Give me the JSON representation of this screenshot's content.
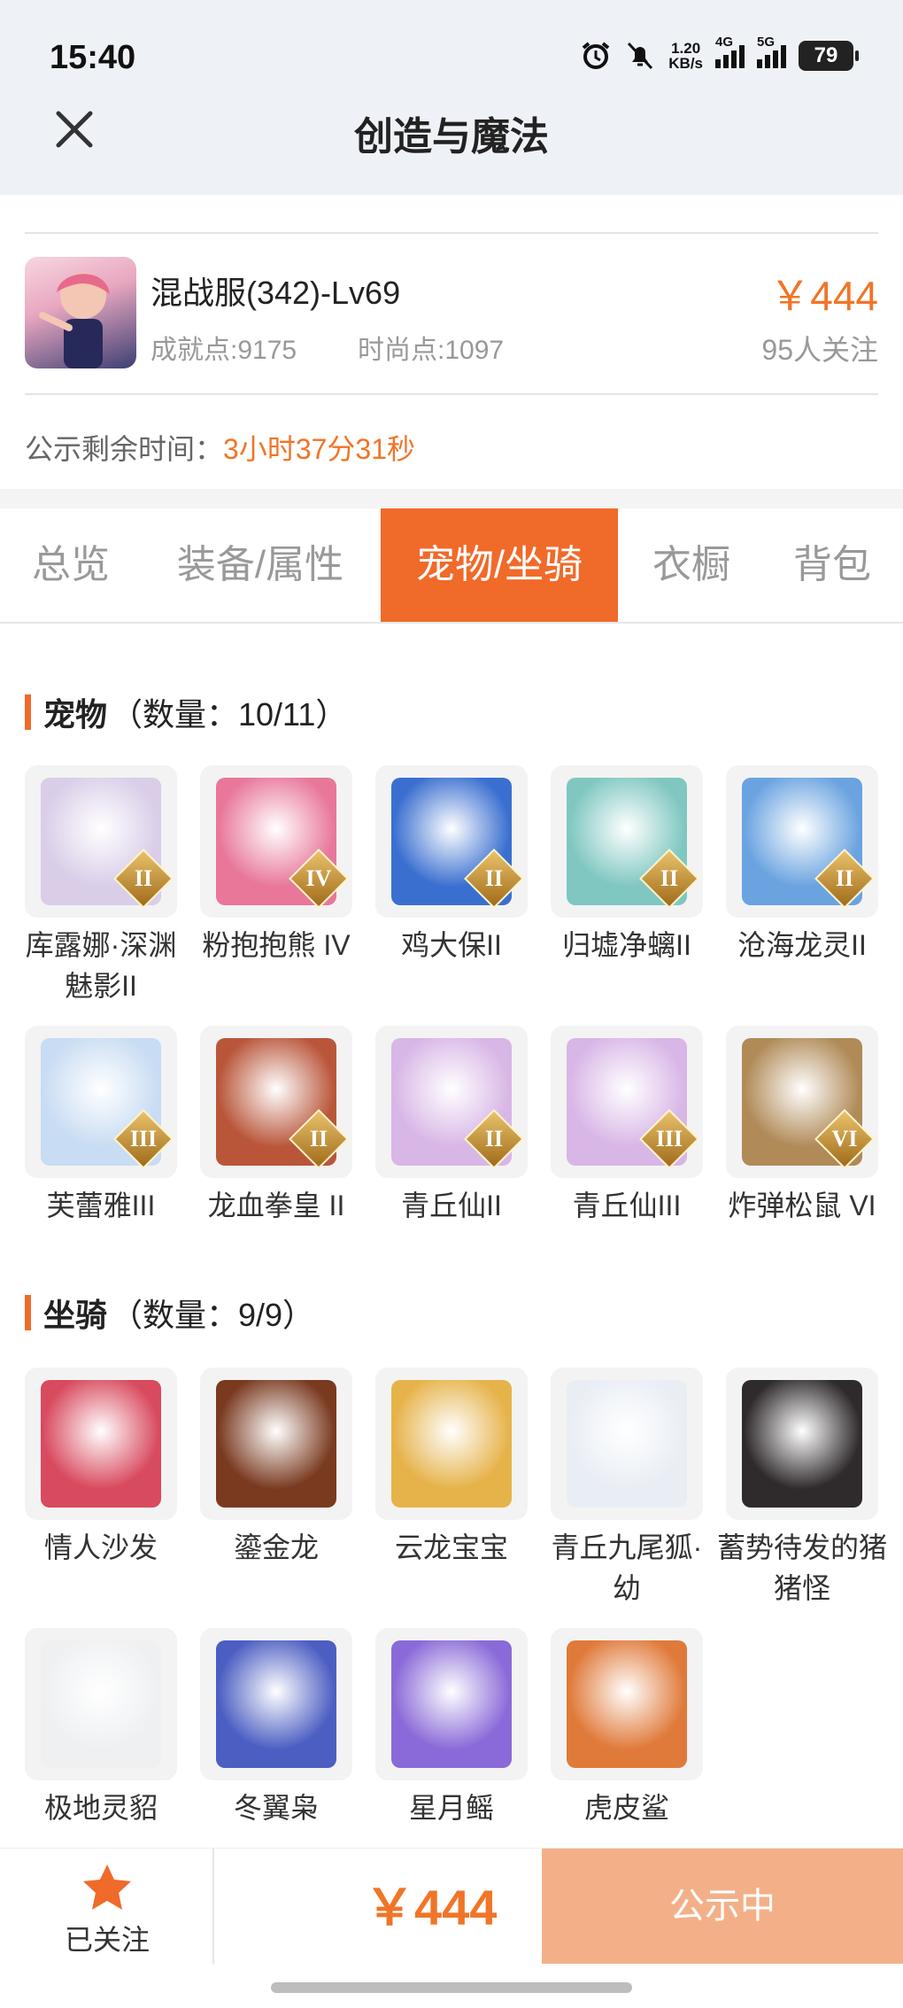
{
  "status_bar": {
    "time": "15:40",
    "speed": "1.20",
    "speed_unit": "KB/s",
    "net1": "4G",
    "net2": "5G",
    "battery": "79"
  },
  "header": {
    "title": "创造与魔法"
  },
  "seller": {
    "server": "混战服(342)-Lv69",
    "achievement": "成就点:9175",
    "fashion": "时尚点:1097",
    "price": "￥444",
    "followers": "95人关注",
    "remain_label": "公示剩余时间：",
    "remain_value": "3小时37分31秒"
  },
  "tabs": [
    "总览",
    "装备/属性",
    "宠物/坐骑",
    "衣橱",
    "背包"
  ],
  "active_tab": 2,
  "pets": {
    "title": "宠物",
    "count": "（数量：10/11）",
    "items": [
      {
        "name": "库露娜·深渊魅影II",
        "badge": "II",
        "color": "#d9cde8"
      },
      {
        "name": "粉抱抱熊 IV",
        "badge": "IV",
        "color": "#e8779a"
      },
      {
        "name": "鸡大保II",
        "badge": "II",
        "color": "#3a6fd0"
      },
      {
        "name": "归墟净螭II",
        "badge": "II",
        "color": "#7fc7c0"
      },
      {
        "name": "沧海龙灵II",
        "badge": "II",
        "color": "#6aa3e0"
      },
      {
        "name": "芙蕾雅III",
        "badge": "III",
        "color": "#c8dcf3"
      },
      {
        "name": "龙血拳皇 II",
        "badge": "II",
        "color": "#b9563a"
      },
      {
        "name": "青丘仙II",
        "badge": "II",
        "color": "#d8b6e6"
      },
      {
        "name": "青丘仙III",
        "badge": "III",
        "color": "#d8b6e6"
      },
      {
        "name": "炸弹松鼠 VI",
        "badge": "VI",
        "color": "#b08a57"
      }
    ]
  },
  "mounts": {
    "title": "坐骑",
    "count": "（数量：9/9）",
    "items": [
      {
        "name": "情人沙发",
        "color": "#d84a5e"
      },
      {
        "name": "鎏金龙",
        "color": "#7a3a20"
      },
      {
        "name": "云龙宝宝",
        "color": "#e6b34a"
      },
      {
        "name": "青丘九尾狐·幼",
        "color": "#e9eef5"
      },
      {
        "name": "蓄势待发的猪猪怪",
        "color": "#2f2a2c"
      },
      {
        "name": "极地灵貂",
        "color": "#eef0f2"
      },
      {
        "name": "冬翼枭",
        "color": "#4c5ec2"
      },
      {
        "name": "星月鳐",
        "color": "#8a6ad8"
      },
      {
        "name": "虎皮鲨",
        "color": "#e07a3a"
      }
    ]
  },
  "bottom": {
    "follow_label": "已关注",
    "price": "￥444",
    "cta": "公示中"
  },
  "colors": {
    "accent": "#f06a2a",
    "price": "#f07528",
    "cta_bg": "#f3b088"
  }
}
